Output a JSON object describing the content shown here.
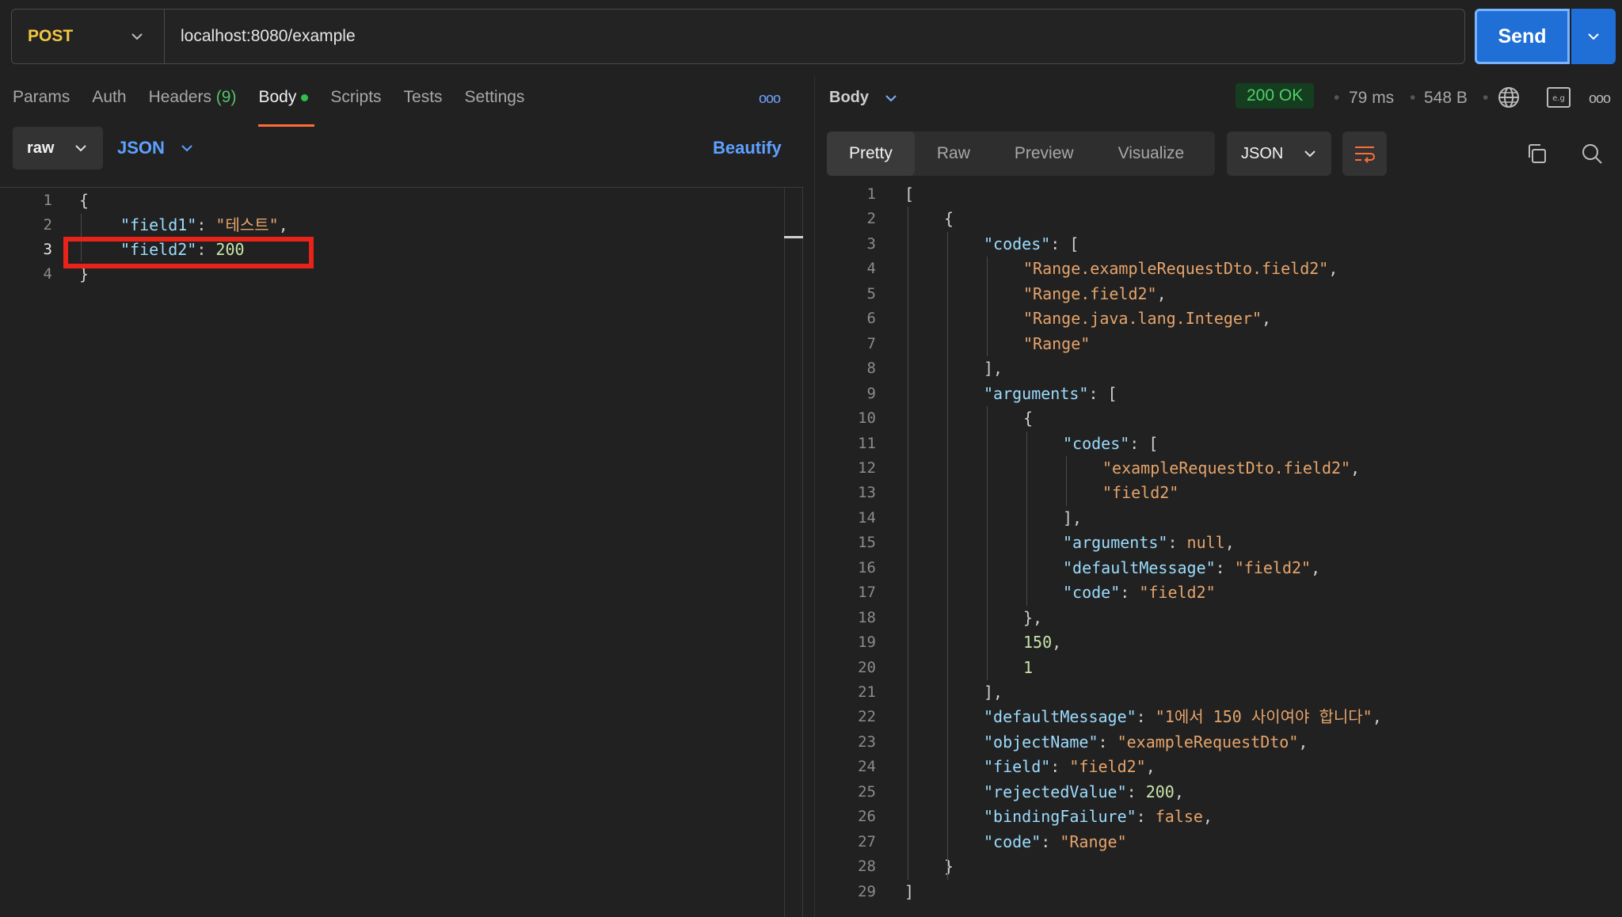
{
  "request": {
    "method": "POST",
    "url": "localhost:8080/example",
    "send_label": "Send",
    "tabs": [
      {
        "label": "Params"
      },
      {
        "label": "Auth"
      },
      {
        "label": "Headers",
        "count": "(9)"
      },
      {
        "label": "Body"
      },
      {
        "label": "Scripts"
      },
      {
        "label": "Tests"
      },
      {
        "label": "Settings"
      }
    ],
    "more": "ooo",
    "body_mode": "raw",
    "body_format": "JSON",
    "beautify_label": "Beautify",
    "code": [
      {
        "n": "1",
        "text": "{"
      },
      {
        "n": "2",
        "key": "\"field1\"",
        "sep": ": ",
        "val": "\"테스트\"",
        "tail": ","
      },
      {
        "n": "3",
        "key": "\"field2\"",
        "sep": ": ",
        "num": "200",
        "tail": ""
      },
      {
        "n": "4",
        "text": "}"
      }
    ]
  },
  "response": {
    "body_label": "Body",
    "status": "200 OK",
    "time": "79 ms",
    "size": "548 B",
    "tabs": [
      "Pretty",
      "Raw",
      "Preview",
      "Visualize"
    ],
    "format": "JSON",
    "code": [
      {
        "n": "1",
        "i": 0,
        "p": "["
      },
      {
        "n": "2",
        "i": 1,
        "p": "{"
      },
      {
        "n": "3",
        "i": 2,
        "k": "\"codes\"",
        "p": ": ["
      },
      {
        "n": "4",
        "i": 3,
        "s": "\"Range.exampleRequestDto.field2\"",
        "p": ","
      },
      {
        "n": "5",
        "i": 3,
        "s": "\"Range.field2\"",
        "p": ","
      },
      {
        "n": "6",
        "i": 3,
        "s": "\"Range.java.lang.Integer\"",
        "p": ","
      },
      {
        "n": "7",
        "i": 3,
        "s": "\"Range\""
      },
      {
        "n": "8",
        "i": 2,
        "p": "],"
      },
      {
        "n": "9",
        "i": 2,
        "k": "\"arguments\"",
        "p": ": ["
      },
      {
        "n": "10",
        "i": 3,
        "p": "{"
      },
      {
        "n": "11",
        "i": 4,
        "k": "\"codes\"",
        "p": ": ["
      },
      {
        "n": "12",
        "i": 5,
        "s": "\"exampleRequestDto.field2\"",
        "p": ","
      },
      {
        "n": "13",
        "i": 5,
        "s": "\"field2\""
      },
      {
        "n": "14",
        "i": 4,
        "p": "],"
      },
      {
        "n": "15",
        "i": 4,
        "k": "\"arguments\"",
        "p": ": ",
        "l": "null",
        "p2": ","
      },
      {
        "n": "16",
        "i": 4,
        "k": "\"defaultMessage\"",
        "p": ": ",
        "s2": "\"field2\"",
        "p2": ","
      },
      {
        "n": "17",
        "i": 4,
        "k": "\"code\"",
        "p": ": ",
        "s2": "\"field2\""
      },
      {
        "n": "18",
        "i": 3,
        "p": "},"
      },
      {
        "n": "19",
        "i": 3,
        "num": "150",
        "p2": ","
      },
      {
        "n": "20",
        "i": 3,
        "num": "1"
      },
      {
        "n": "21",
        "i": 2,
        "p": "],"
      },
      {
        "n": "22",
        "i": 2,
        "k": "\"defaultMessage\"",
        "p": ": ",
        "s2": "\"1에서 150 사이여야 합니다\"",
        "p2": ","
      },
      {
        "n": "23",
        "i": 2,
        "k": "\"objectName\"",
        "p": ": ",
        "s2": "\"exampleRequestDto\"",
        "p2": ","
      },
      {
        "n": "24",
        "i": 2,
        "k": "\"field\"",
        "p": ": ",
        "s2": "\"field2\"",
        "p2": ","
      },
      {
        "n": "25",
        "i": 2,
        "k": "\"rejectedValue\"",
        "p": ": ",
        "num2": "200",
        "p2": ","
      },
      {
        "n": "26",
        "i": 2,
        "k": "\"bindingFailure\"",
        "p": ": ",
        "l": "false",
        "p2": ","
      },
      {
        "n": "27",
        "i": 2,
        "k": "\"code\"",
        "p": ": ",
        "s2": "\"Range\""
      },
      {
        "n": "28",
        "i": 1,
        "p": "}"
      },
      {
        "n": "29",
        "i": 0,
        "p": "]"
      }
    ]
  }
}
